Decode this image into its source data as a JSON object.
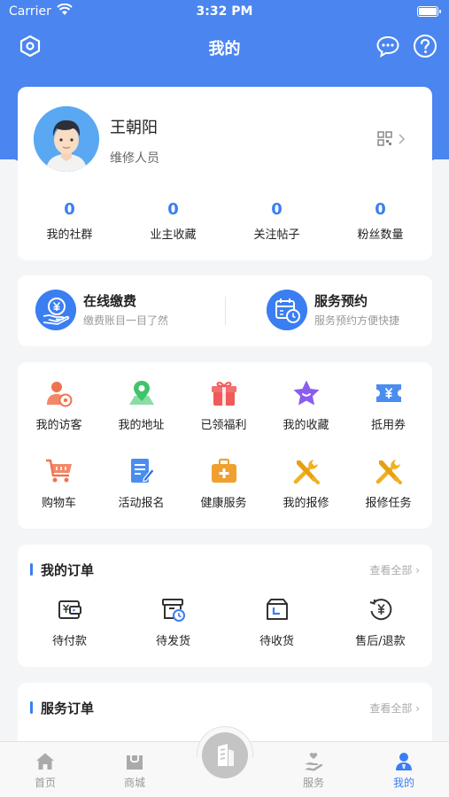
{
  "status": {
    "carrier": "Carrier",
    "time": "3:32 PM"
  },
  "nav": {
    "title": "我的",
    "left_icon": "settings-hex-icon",
    "right_icons": [
      "message-icon",
      "help-icon"
    ]
  },
  "profile": {
    "name": "王朝阳",
    "role": "维修人员",
    "qr_icon": "qr-code-icon"
  },
  "stats": [
    {
      "value": "0",
      "label": "我的社群"
    },
    {
      "value": "0",
      "label": "业主收藏"
    },
    {
      "value": "0",
      "label": "关注帖子"
    },
    {
      "value": "0",
      "label": "粉丝数量"
    }
  ],
  "pay": {
    "left": {
      "title": "在线缴费",
      "subtitle": "缴费账目一目了然",
      "icon": "yen-hand-icon"
    },
    "right": {
      "title": "服务预约",
      "subtitle": "服务预约方便快捷",
      "icon": "calendar-clock-icon"
    }
  },
  "grid": [
    {
      "label": "我的访客",
      "icon": "visitor-icon",
      "color": "#f0734f"
    },
    {
      "label": "我的地址",
      "icon": "map-pin-icon",
      "color": "#3fc46a"
    },
    {
      "label": "已领福利",
      "icon": "gift-icon",
      "color": "#f05a5a"
    },
    {
      "label": "我的收藏",
      "icon": "star-icon",
      "color": "#8a5cf0"
    },
    {
      "label": "抵用券",
      "icon": "coupon-icon",
      "color": "#4a8df0"
    },
    {
      "label": "购物车",
      "icon": "cart-icon",
      "color": "#f0734f"
    },
    {
      "label": "活动报名",
      "icon": "form-icon",
      "color": "#4a8df0"
    },
    {
      "label": "健康服务",
      "icon": "medkit-icon",
      "color": "#f0a030"
    },
    {
      "label": "我的报修",
      "icon": "tools-icon",
      "color": "#f0b020"
    },
    {
      "label": "报修任务",
      "icon": "tools-task-icon",
      "color": "#f0b020"
    }
  ],
  "orders": {
    "title": "我的订单",
    "more": "查看全部",
    "items": [
      {
        "label": "待付款",
        "icon": "wallet-icon"
      },
      {
        "label": "待发货",
        "icon": "box-clock-icon"
      },
      {
        "label": "待收货",
        "icon": "box-receive-icon"
      },
      {
        "label": "售后/退款",
        "icon": "refund-icon"
      }
    ]
  },
  "service_orders": {
    "title": "服务订单",
    "more": "查看全部"
  },
  "tabs": [
    {
      "label": "首页",
      "icon": "home-icon"
    },
    {
      "label": "商城",
      "icon": "shop-icon"
    },
    {
      "label": "",
      "icon": "center-building-icon"
    },
    {
      "label": "服务",
      "icon": "service-hand-icon"
    },
    {
      "label": "我的",
      "icon": "person-icon"
    }
  ],
  "colors": {
    "accent": "#3a7ef2",
    "header": "#4a85f0",
    "tab_active": "#3a7ef2",
    "tab_inactive": "#999999"
  }
}
